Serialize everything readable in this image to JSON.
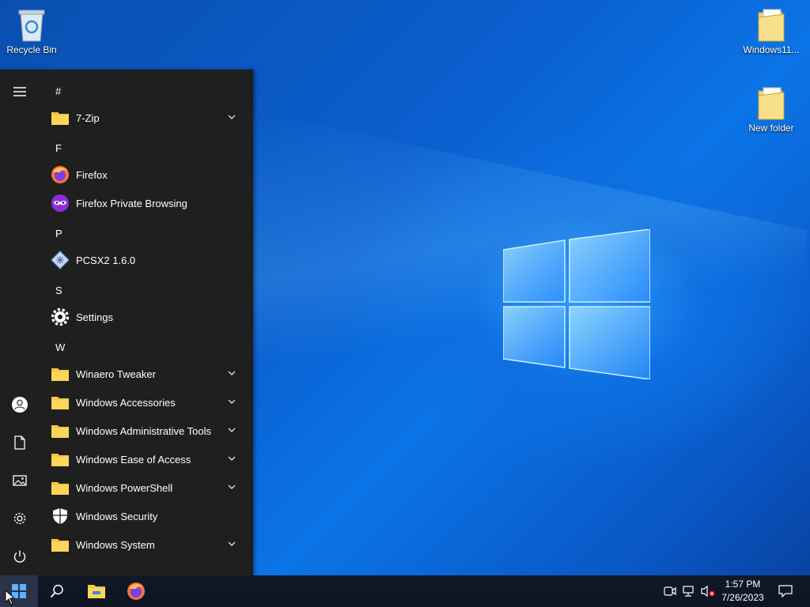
{
  "desktop": {
    "icons": [
      {
        "label": "Recycle Bin"
      },
      {
        "label": "Windows11..."
      },
      {
        "label": "New folder"
      }
    ]
  },
  "start_menu": {
    "headers": [
      "#",
      "F",
      "P",
      "S",
      "W"
    ],
    "items": [
      {
        "label": "7-Zip",
        "icon": "folder-icon",
        "expandable": true
      },
      {
        "label": "Firefox",
        "icon": "firefox-icon",
        "expandable": false
      },
      {
        "label": "Firefox Private Browsing",
        "icon": "firefox-private-icon",
        "expandable": false
      },
      {
        "label": "PCSX2 1.6.0",
        "icon": "pcsx2-icon",
        "expandable": false
      },
      {
        "label": "Settings",
        "icon": "gear-icon",
        "expandable": false
      },
      {
        "label": "Winaero Tweaker",
        "icon": "folder-icon",
        "expandable": true
      },
      {
        "label": "Windows Accessories",
        "icon": "folder-icon",
        "expandable": true
      },
      {
        "label": "Windows Administrative Tools",
        "icon": "folder-icon",
        "expandable": true
      },
      {
        "label": "Windows Ease of Access",
        "icon": "folder-icon",
        "expandable": true
      },
      {
        "label": "Windows PowerShell",
        "icon": "folder-icon",
        "expandable": true
      },
      {
        "label": "Windows Security",
        "icon": "shield-icon",
        "expandable": false
      },
      {
        "label": "Windows System",
        "icon": "folder-icon",
        "expandable": true
      }
    ],
    "rail": [
      "hamburger-icon",
      "user-icon",
      "document-icon",
      "pictures-icon",
      "settings-icon",
      "power-icon"
    ]
  },
  "taskbar": {
    "buttons": [
      "start-icon",
      "search-icon",
      "file-explorer-icon",
      "firefox-icon"
    ],
    "tray": [
      "meet-now-icon",
      "network-icon",
      "volume-muted-icon",
      "notification-icon"
    ],
    "time": "1:57 PM",
    "date": "7/26/2023"
  },
  "colors": {
    "folder": "#f5c842",
    "start_bg": "#1f1f1f",
    "taskbar_bg": "#111826"
  }
}
